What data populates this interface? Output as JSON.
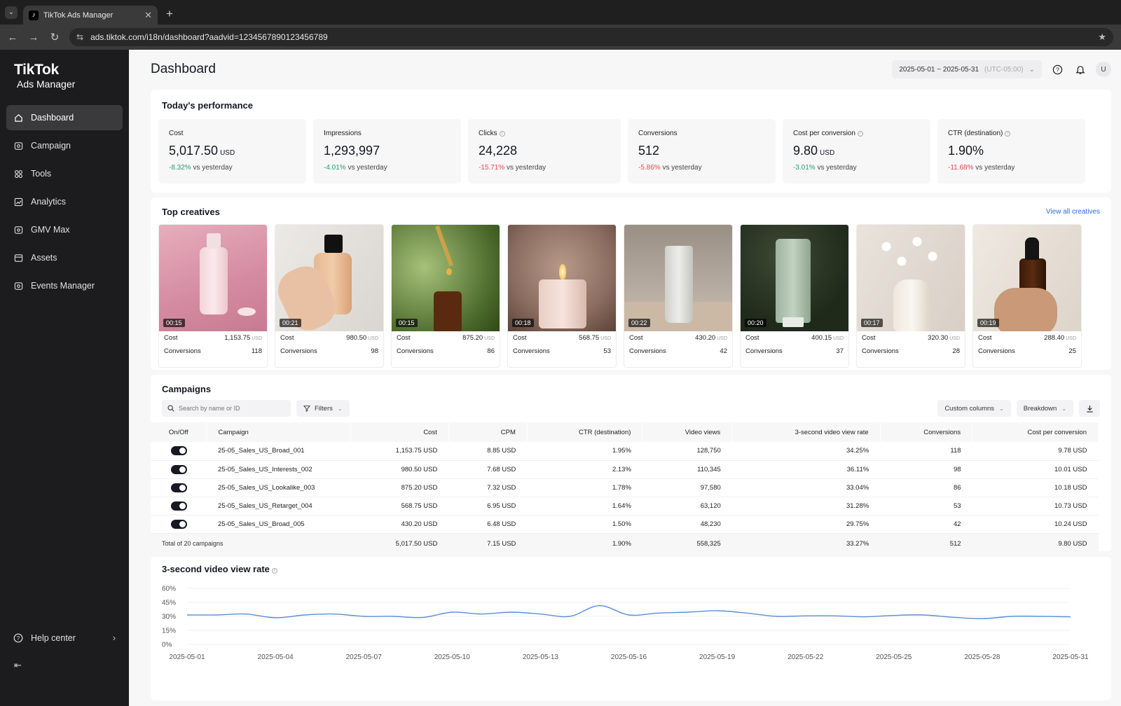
{
  "browser": {
    "tab_title": "TikTok Ads Manager",
    "url": "ads.tiktok.com/i18n/dashboard?aadvid=1234567890123456789"
  },
  "sidebar": {
    "brand_line1": "TikTok",
    "brand_line2": "Ads Manager",
    "items": [
      {
        "label": "Dashboard",
        "icon": "home-icon"
      },
      {
        "label": "Campaign",
        "icon": "campaign-icon"
      },
      {
        "label": "Tools",
        "icon": "tools-icon"
      },
      {
        "label": "Analytics",
        "icon": "analytics-icon"
      },
      {
        "label": "GMV Max",
        "icon": "gmv-icon"
      },
      {
        "label": "Assets",
        "icon": "assets-icon"
      },
      {
        "label": "Events Manager",
        "icon": "events-icon"
      }
    ],
    "help_label": "Help center"
  },
  "header": {
    "title": "Dashboard",
    "date_range": "2025-05-01 ~ 2025-05-31",
    "timezone": "(UTC-05:00)",
    "avatar_initial": "U"
  },
  "performance": {
    "title": "Today's performance",
    "metrics": [
      {
        "label": "Cost",
        "value": "5,017.50",
        "unit": "USD",
        "change": "-8.32%",
        "suffix": "vs yesterday",
        "trend": "pos"
      },
      {
        "label": "Impressions",
        "value": "1,293,997",
        "unit": "",
        "change": "-4.01%",
        "suffix": "vs yesterday",
        "trend": "pos"
      },
      {
        "label": "Clicks",
        "value": "24,228",
        "unit": "",
        "change": "-15.71%",
        "suffix": "vs yesterday",
        "trend": "neg"
      },
      {
        "label": "Conversions",
        "value": "512",
        "unit": "",
        "change": "-5.86%",
        "suffix": "vs yesterday",
        "trend": "neg"
      },
      {
        "label": "Cost per conversion",
        "value": "9.80",
        "unit": "USD",
        "change": "-3.01%",
        "suffix": "vs yesterday",
        "trend": "pos"
      },
      {
        "label": "CTR (destination)",
        "value": "1.90%",
        "unit": "",
        "change": "-11.68%",
        "suffix": "vs yesterday",
        "trend": "neg"
      }
    ]
  },
  "creatives": {
    "title": "Top creatives",
    "view_all": "View all creatives",
    "cost_label": "Cost",
    "conv_label": "Conversions",
    "unit": "USD",
    "items": [
      {
        "duration": "00:15",
        "cost": "1,153.75",
        "conversions": "118"
      },
      {
        "duration": "00:21",
        "cost": "980.50",
        "conversions": "98"
      },
      {
        "duration": "00:15",
        "cost": "875.20",
        "conversions": "86"
      },
      {
        "duration": "00:18",
        "cost": "568.75",
        "conversions": "53"
      },
      {
        "duration": "00:22",
        "cost": "430.20",
        "conversions": "42"
      },
      {
        "duration": "00:20",
        "cost": "400.15",
        "conversions": "37"
      },
      {
        "duration": "00:17",
        "cost": "320.30",
        "conversions": "28"
      },
      {
        "duration": "00:19",
        "cost": "288.40",
        "conversions": "25"
      }
    ]
  },
  "campaigns": {
    "title": "Campaigns",
    "search_placeholder": "Search by name or ID",
    "filters_label": "Filters",
    "custom_columns_label": "Custom columns",
    "breakdown_label": "Breakdown",
    "columns": [
      "On/Off",
      "Campaign",
      "Cost",
      "CPM",
      "CTR (destination)",
      "Video views",
      "3-second video view rate",
      "Conversions",
      "Cost per conversion"
    ],
    "rows": [
      {
        "name": "25-05_Sales_US_Broad_001",
        "cost": "1,153.75 USD",
        "cpm": "8.85 USD",
        "ctr": "1.95%",
        "views": "128,750",
        "rate": "34.25%",
        "conv": "118",
        "cpc": "9.78 USD"
      },
      {
        "name": "25-05_Sales_US_Interests_002",
        "cost": "980.50 USD",
        "cpm": "7.68 USD",
        "ctr": "2.13%",
        "views": "110,345",
        "rate": "36.11%",
        "conv": "98",
        "cpc": "10.01 USD"
      },
      {
        "name": "25-05_Sales_US_Lookalike_003",
        "cost": "875.20 USD",
        "cpm": "7.32 USD",
        "ctr": "1.78%",
        "views": "97,580",
        "rate": "33.04%",
        "conv": "86",
        "cpc": "10.18 USD"
      },
      {
        "name": "25-05_Sales_US_Retarget_004",
        "cost": "568.75 USD",
        "cpm": "6.95 USD",
        "ctr": "1.64%",
        "views": "63,120",
        "rate": "31.28%",
        "conv": "53",
        "cpc": "10.73 USD"
      },
      {
        "name": "25-05_Sales_US_Broad_005",
        "cost": "430.20 USD",
        "cpm": "6.48 USD",
        "ctr": "1.50%",
        "views": "48,230",
        "rate": "29.75%",
        "conv": "42",
        "cpc": "10.24 USD"
      }
    ],
    "total": {
      "label": "Total of 20 campaigns",
      "cost": "5,017.50 USD",
      "cpm": "7.15 USD",
      "ctr": "1.90%",
      "views": "558,325",
      "rate": "33.27%",
      "conv": "512",
      "cpc": "9.80 USD"
    }
  },
  "chart_data": {
    "type": "line",
    "title": "3-second video view rate",
    "xlabel": "",
    "ylabel": "",
    "ylim": [
      0,
      60
    ],
    "yticks": [
      "0%",
      "15%",
      "30%",
      "45%",
      "60%"
    ],
    "xticks": [
      "2025-05-01",
      "2025-05-04",
      "2025-05-07",
      "2025-05-10",
      "2025-05-13",
      "2025-05-16",
      "2025-05-19",
      "2025-05-22",
      "2025-05-25",
      "2025-05-28",
      "2025-05-31"
    ],
    "line_color": "#5b8fd6",
    "x": [
      "2025-05-01",
      "2025-05-02",
      "2025-05-03",
      "2025-05-04",
      "2025-05-05",
      "2025-05-06",
      "2025-05-07",
      "2025-05-08",
      "2025-05-09",
      "2025-05-10",
      "2025-05-11",
      "2025-05-12",
      "2025-05-13",
      "2025-05-14",
      "2025-05-15",
      "2025-05-16",
      "2025-05-17",
      "2025-05-18",
      "2025-05-19",
      "2025-05-20",
      "2025-05-21",
      "2025-05-22",
      "2025-05-23",
      "2025-05-24",
      "2025-05-25",
      "2025-05-26",
      "2025-05-27",
      "2025-05-28",
      "2025-05-29",
      "2025-05-30",
      "2025-05-31"
    ],
    "values": [
      31.5,
      31.5,
      32.5,
      28.5,
      31.5,
      32.5,
      30.0,
      30.0,
      28.8,
      34.5,
      32.5,
      34.5,
      32.5,
      30.0,
      41.5,
      31.5,
      33.5,
      34.5,
      36.0,
      33.5,
      30.0,
      30.5,
      30.5,
      29.5,
      31.0,
      31.5,
      29.0,
      27.5,
      30.0,
      30.0,
      29.5
    ]
  }
}
